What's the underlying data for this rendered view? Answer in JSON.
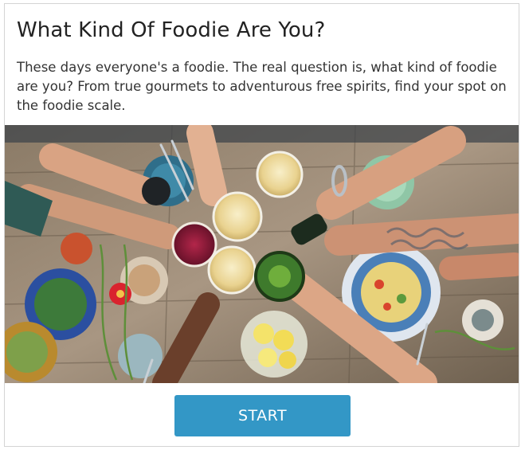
{
  "quiz": {
    "title": "What Kind Of Foodie Are You?",
    "description": "These days everyone's a foodie. The real question is, what kind of foodie are you? From true gourmets to adventurous free spirits, find your spot on the foodie scale.",
    "start_label": "START"
  },
  "colors": {
    "accent": "#3397c6",
    "border": "#d4d4d4"
  },
  "image": {
    "subject": "friends toasting drinks over a rustic wooden table with plates of food"
  }
}
